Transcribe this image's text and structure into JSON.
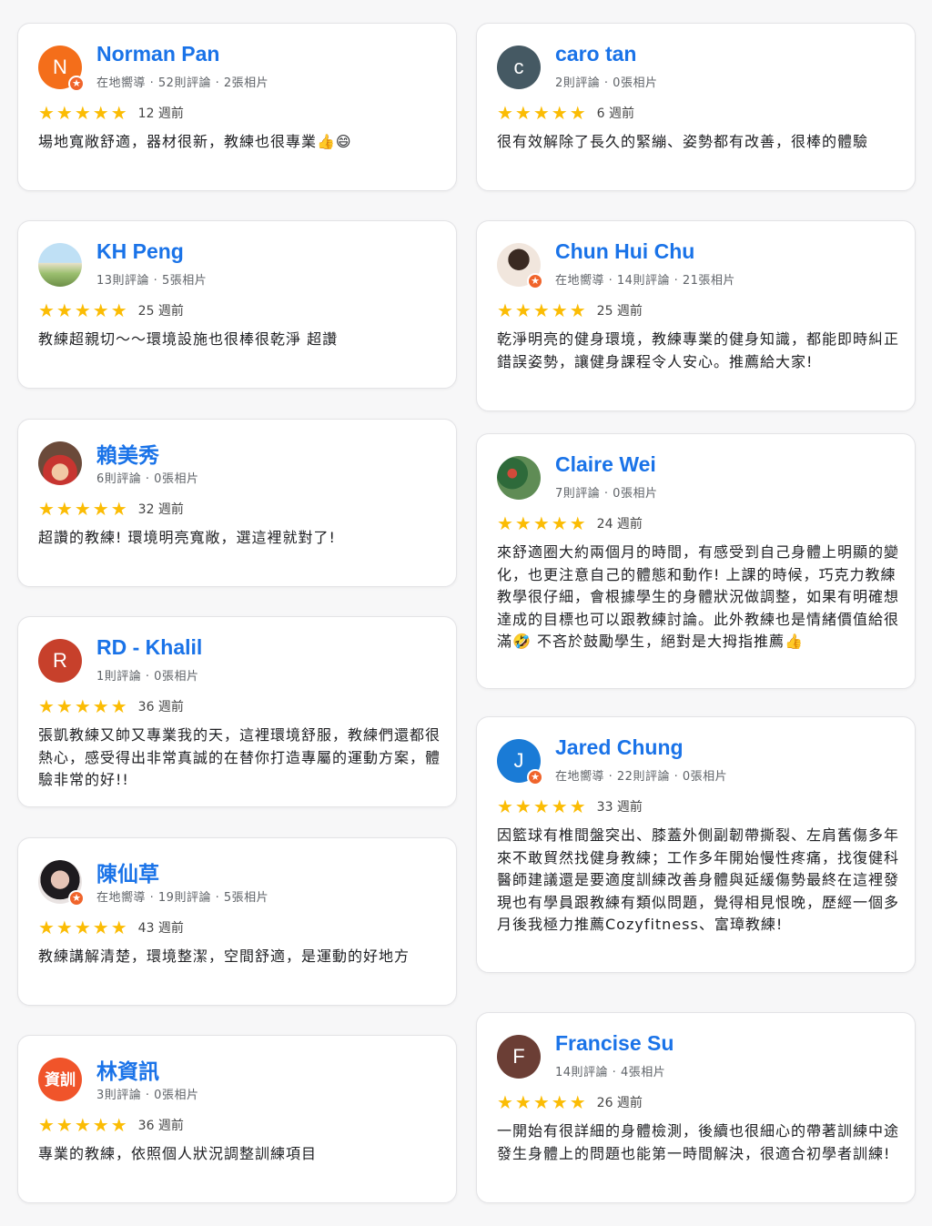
{
  "reviews": [
    {
      "name": "Norman Pan",
      "meta": "在地嚮導 · 52則評論 · 2張相片",
      "stars": "★★★★★",
      "when": "12 週前",
      "text": "場地寬敞舒適，器材很新，教練也很專業👍😄",
      "avatar": "N",
      "guide": true
    },
    {
      "name": "caro tan",
      "meta": "2則評論 · 0張相片",
      "stars": "★★★★★",
      "when": "6 週前",
      "text": "很有效解除了長久的緊繃、姿勢都有改善，很棒的體驗",
      "avatar": "c",
      "guide": false
    },
    {
      "name": "KH Peng",
      "meta": "13則評論 · 5張相片",
      "stars": "★★★★★",
      "when": "25 週前",
      "text": "教練超親切～～環境設施也很棒很乾淨 超讚",
      "avatar": "",
      "guide": false
    },
    {
      "name": "Chun Hui Chu",
      "meta": "在地嚮導 · 14則評論 · 21張相片",
      "stars": "★★★★★",
      "when": "25 週前",
      "text": "乾淨明亮的健身環境，教練專業的健身知識，都能即時糾正錯誤姿勢，讓健身課程令人安心。推薦給大家!",
      "avatar": "",
      "guide": true
    },
    {
      "name": "賴美秀",
      "meta": "6則評論 · 0張相片",
      "stars": "★★★★★",
      "when": "32 週前",
      "text": "超讚的教練! 環境明亮寬敞，選這裡就對了!",
      "avatar": "",
      "guide": false
    },
    {
      "name": "Claire Wei",
      "meta": "7則評論 · 0張相片",
      "stars": "★★★★★",
      "when": "24 週前",
      "text": "來舒適圈大約兩個月的時間，有感受到自己身體上明顯的變化，也更注意自己的體態和動作! 上課的時候，巧克力教練教學很仔細，會根據學生的身體狀況做調整，如果有明確想達成的目標也可以跟教練討論。此外教練也是情緒價值給很滿🤣 不吝於鼓勵學生，絕對是大拇指推薦👍",
      "avatar": "",
      "guide": false
    },
    {
      "name": "RD - Khalil",
      "meta": "1則評論 · 0張相片",
      "stars": "★★★★★",
      "when": "36 週前",
      "text": "張凱教練又帥又專業我的天，這裡環境舒服，教練們還都很熱心，感受得出非常真誠的在替你打造專屬的運動方案，體驗非常的好!!",
      "avatar": "R",
      "guide": false
    },
    {
      "name": "Jared Chung",
      "meta": "在地嚮導 · 22則評論 · 0張相片",
      "stars": "★★★★★",
      "when": "33 週前",
      "text": "因籃球有椎間盤突出、膝蓋外側副韌帶撕裂、左肩舊傷多年來不敢貿然找健身教練；工作多年開始慢性疼痛，找復健科醫師建議還是要適度訓練改善身體與延緩傷勢最終在這裡發現也有學員跟教練有類似問題，覺得相見恨晚，歷經一個多月後我極力推薦Cozyfitness、富璋教練!",
      "avatar": "J",
      "guide": true
    },
    {
      "name": "陳仙草",
      "meta": "在地嚮導 · 19則評論 · 5張相片",
      "stars": "★★★★★",
      "when": "43 週前",
      "text": "教練講解清楚，環境整潔，空間舒適，是運動的好地方",
      "avatar": "",
      "guide": true
    },
    {
      "name": "Francise Su",
      "meta": "14則評論 · 4張相片",
      "stars": "★★★★★",
      "when": "26 週前",
      "text": "一開始有很詳細的身體檢測，後續也很細心的帶著訓練中途發生身體上的問題也能第一時間解決，很適合初學者訓練!",
      "avatar": "F",
      "guide": false
    },
    {
      "name": "林資訊",
      "meta": "3則評論 · 0張相片",
      "stars": "★★★★★",
      "when": "36 週前",
      "text": "專業的教練，依照個人狀況調整訓練項目",
      "avatar": "資訓",
      "guide": false
    }
  ],
  "colors": {
    "name": "#1a73e8",
    "star": "#fbbc04",
    "guide_badge": "#f0642b"
  },
  "icons": {
    "star": "star-icon",
    "guide": "local-guide-badge-icon"
  }
}
